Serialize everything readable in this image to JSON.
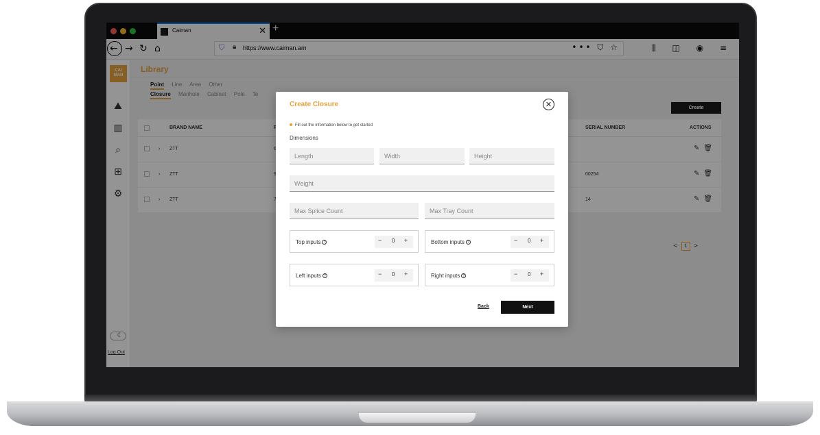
{
  "browser": {
    "tab_title": "Caiman",
    "tab_close": "✕",
    "new_tab": "+",
    "url": "https://www.caiman.am",
    "url_actions": "••• ⛉ ☆",
    "toolbar_icons": "⫼ ◫ ◉ ≡"
  },
  "sidebar": {
    "logo_text": "CAI MAN",
    "logout": "Log Out"
  },
  "library": {
    "title": "Library",
    "type_tabs": [
      "Point",
      "Line",
      "Area",
      "Other"
    ],
    "sub_tabs": [
      "Closure",
      "Manhole",
      "Cabinet",
      "Pole",
      "Te"
    ],
    "create_label": "Create",
    "columns": {
      "brand": "BRAND NAME",
      "p": "P",
      "serial": "SERIAL NUMBER",
      "actions": "ACTIONS"
    },
    "rows": [
      {
        "brand": "ZTT",
        "p": "6",
        "serial": ""
      },
      {
        "brand": "ZTT",
        "p": "9",
        "serial": "00254"
      },
      {
        "brand": "ZTT",
        "p": "7",
        "serial": "14"
      }
    ],
    "pager": {
      "prev": "<",
      "current": "1",
      "next": ">"
    }
  },
  "modal": {
    "title": "Create Closure",
    "note": "Fill out the information below to get started",
    "section": "Dimensions",
    "length_ph": "Length",
    "width_ph": "Width",
    "height_ph": "Height",
    "weight_ph": "Weight",
    "max_splice_ph": "Max Splice Count",
    "max_tray_ph": "Max Tray Count",
    "top_inputs": {
      "label": "Top inputs",
      "value": "0"
    },
    "bottom_inputs": {
      "label": "Bottom inputs",
      "value": "0"
    },
    "left_inputs": {
      "label": "Left inputs",
      "value": "0"
    },
    "right_inputs": {
      "label": "Right inputs",
      "value": "0"
    },
    "back_label": "Back",
    "next_label": "Next"
  },
  "colors": {
    "accent": "#e8a33d",
    "dark": "#111111"
  }
}
